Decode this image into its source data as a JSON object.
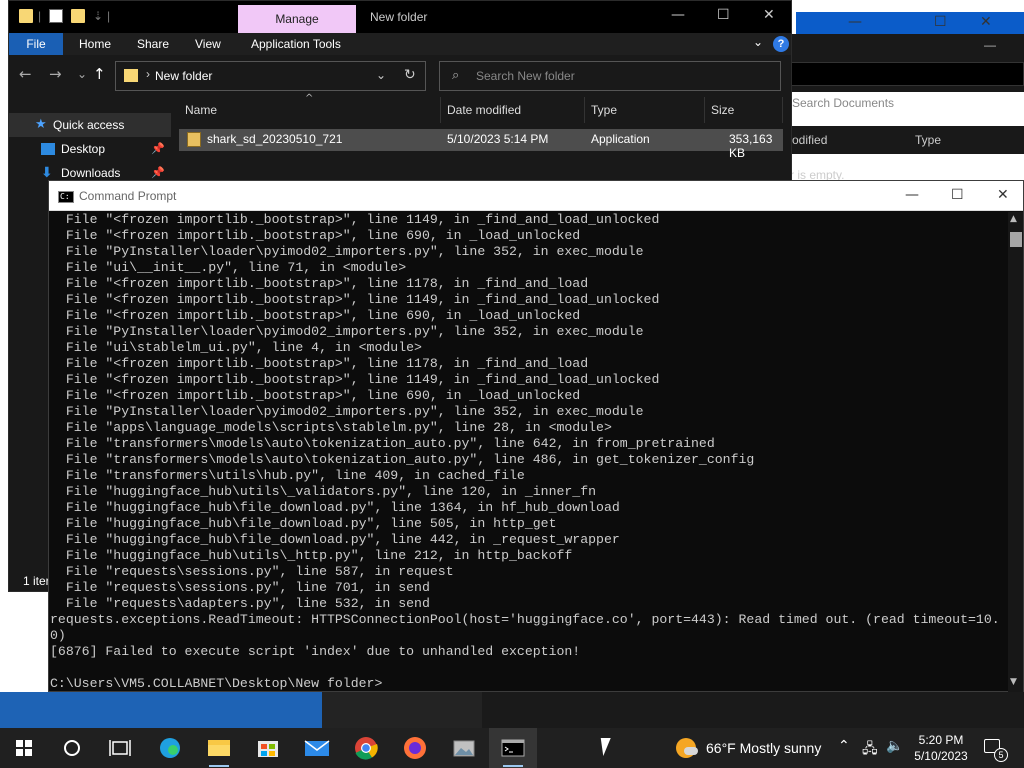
{
  "background_explorer": {
    "search_placeholder": "Search Documents",
    "col_modified": "odified",
    "col_type": "Type",
    "empty_text": "r is empty."
  },
  "explorer": {
    "title": "New folder",
    "manage_tab": "Manage",
    "ribbon_tabs": [
      "File",
      "Home",
      "Share",
      "View",
      "Application Tools"
    ],
    "address": "New folder",
    "search_placeholder": "Search New folder",
    "nav_items": [
      "Quick access",
      "Desktop",
      "Downloads"
    ],
    "columns": [
      "Name",
      "Date modified",
      "Type",
      "Size"
    ],
    "files": [
      {
        "name": "shark_sd_20230510_721",
        "date": "5/10/2023 5:14 PM",
        "type": "Application",
        "size": "353,163 KB"
      }
    ],
    "status": "1 iter"
  },
  "cmd": {
    "title": "Command Prompt",
    "lines": [
      "  File \"<frozen importlib._bootstrap>\", line 1149, in _find_and_load_unlocked",
      "  File \"<frozen importlib._bootstrap>\", line 690, in _load_unlocked",
      "  File \"PyInstaller\\loader\\pyimod02_importers.py\", line 352, in exec_module",
      "  File \"ui\\__init__.py\", line 71, in <module>",
      "  File \"<frozen importlib._bootstrap>\", line 1178, in _find_and_load",
      "  File \"<frozen importlib._bootstrap>\", line 1149, in _find_and_load_unlocked",
      "  File \"<frozen importlib._bootstrap>\", line 690, in _load_unlocked",
      "  File \"PyInstaller\\loader\\pyimod02_importers.py\", line 352, in exec_module",
      "  File \"ui\\stablelm_ui.py\", line 4, in <module>",
      "  File \"<frozen importlib._bootstrap>\", line 1178, in _find_and_load",
      "  File \"<frozen importlib._bootstrap>\", line 1149, in _find_and_load_unlocked",
      "  File \"<frozen importlib._bootstrap>\", line 690, in _load_unlocked",
      "  File \"PyInstaller\\loader\\pyimod02_importers.py\", line 352, in exec_module",
      "  File \"apps\\language_models\\scripts\\stablelm.py\", line 28, in <module>",
      "  File \"transformers\\models\\auto\\tokenization_auto.py\", line 642, in from_pretrained",
      "  File \"transformers\\models\\auto\\tokenization_auto.py\", line 486, in get_tokenizer_config",
      "  File \"transformers\\utils\\hub.py\", line 409, in cached_file",
      "  File \"huggingface_hub\\utils\\_validators.py\", line 120, in _inner_fn",
      "  File \"huggingface_hub\\file_download.py\", line 1364, in hf_hub_download",
      "  File \"huggingface_hub\\file_download.py\", line 505, in http_get",
      "  File \"huggingface_hub\\file_download.py\", line 442, in _request_wrapper",
      "  File \"huggingface_hub\\utils\\_http.py\", line 212, in http_backoff",
      "  File \"requests\\sessions.py\", line 587, in request",
      "  File \"requests\\sessions.py\", line 701, in send",
      "  File \"requests\\adapters.py\", line 532, in send",
      "requests.exceptions.ReadTimeout: HTTPSConnectionPool(host='huggingface.co', port=443): Read timed out. (read timeout=10.",
      "0)",
      "[6876] Failed to execute script 'index' due to unhandled exception!",
      "",
      "C:\\Users\\VM5.COLLABNET\\Desktop\\New folder>"
    ]
  },
  "taskbar": {
    "weather_temp": "66°F",
    "weather_text": "Mostly sunny",
    "time": "5:20 PM",
    "date": "5/10/2023",
    "notification_count": "5"
  },
  "colors": {
    "accent": "#1a5fb4",
    "manage_tab": "#f1c8f7",
    "console_bg": "#0c0c0c",
    "console_fg": "#cccccc",
    "taskbar": "#202020"
  }
}
